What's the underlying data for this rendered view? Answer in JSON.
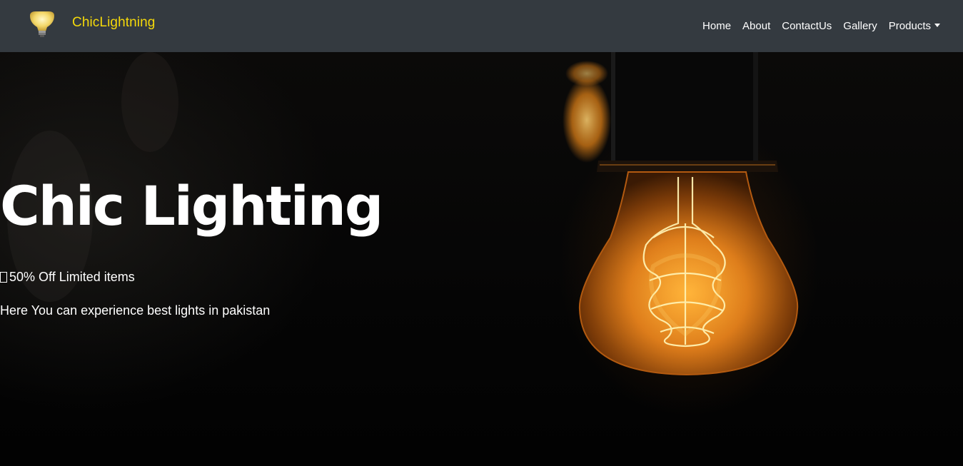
{
  "navbar": {
    "brand_name": "ChicLightning",
    "links": [
      {
        "label": "Home"
      },
      {
        "label": "About"
      },
      {
        "label": "ContactUs"
      },
      {
        "label": "Gallery"
      },
      {
        "label": "Products"
      }
    ]
  },
  "hero": {
    "title": "Chic Lighting",
    "promo": "50% Off Limited items",
    "description": "Here You can experience best lights in pakistan"
  },
  "colors": {
    "navbar_bg": "#343a40",
    "brand": "#f5d90a",
    "hero_text": "#ffffff",
    "bulb_glow": "#ff9a1a"
  },
  "icons": {
    "brand_logo": "light-bulb-icon",
    "products_dropdown": "caret-down-icon",
    "promo_glyph": "missing-glyph-box"
  }
}
